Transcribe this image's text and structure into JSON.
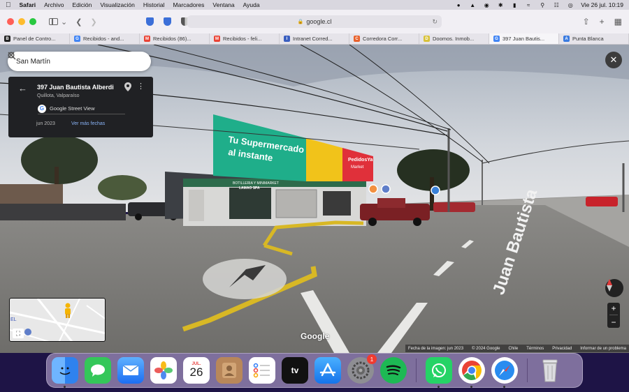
{
  "menubar": {
    "apple_icon": "apple-logo",
    "app_name": "Safari",
    "menus": [
      "Archivo",
      "Edición",
      "Visualización",
      "Historial",
      "Marcadores",
      "Ventana",
      "Ayuda"
    ],
    "datetime": "Vie 26 jul.  10:19"
  },
  "browser": {
    "url": "google.cl",
    "tabs": [
      {
        "label": "Panel de Contro...",
        "favicon": "B",
        "color": "#222222"
      },
      {
        "label": "Recibidos - and...",
        "favicon": "G",
        "color": "#4285f4"
      },
      {
        "label": "Recibidos (86)...",
        "favicon": "M",
        "color": "#ea4335"
      },
      {
        "label": "Recibidos - feli...",
        "favicon": "M",
        "color": "#ea4335"
      },
      {
        "label": "Intranet Corred...",
        "favicon": "I",
        "color": "#3b5fc0"
      },
      {
        "label": "Corredora Corr...",
        "favicon": "C",
        "color": "#e8612c"
      },
      {
        "label": "Doomos. Inmob...",
        "favicon": "D",
        "color": "#d8c23a"
      },
      {
        "label": "397 Juan Bautis...",
        "favicon": "G",
        "color": "#4285f4"
      },
      {
        "label": "Punta Blanca",
        "favicon": "A",
        "color": "#3a7be0"
      }
    ],
    "active_tab": 7
  },
  "streetview": {
    "search_query": "San Martín",
    "address": "397 Juan Bautista Alberdi",
    "locality": "Quillota, Valparaíso",
    "provider": "Google Street View",
    "capture_date": "jun 2023",
    "more_dates": "Ver más fechas",
    "billboard_line1": "Tu Supermercado",
    "billboard_line2": "al instante",
    "billboard_brand": "PedidosYa",
    "billboard_brand2": "Market",
    "store_sign": "BOTILLERIA Y MINIMARKET",
    "store_sign2": "LAMAO SPA",
    "street_name": "Juan Bautista",
    "google_logo": "Google",
    "footer": {
      "image_date": "Fecha de la imagen: jun 2023",
      "copyright": "© 2024 Google",
      "country": "Chile",
      "terms": "Términos",
      "privacy": "Privacidad",
      "report": "Informar de un problema"
    },
    "minimap_label": "EL"
  },
  "dock": {
    "apps": [
      {
        "name": "finder",
        "color": "#3d8df0"
      },
      {
        "name": "messages",
        "color": "#34c759"
      },
      {
        "name": "mail",
        "color": "#2f7cf6"
      },
      {
        "name": "photos",
        "color": "#ffffff"
      },
      {
        "name": "calendar",
        "color": "#ffffff"
      },
      {
        "name": "contacts",
        "color": "#b8875a"
      },
      {
        "name": "reminders",
        "color": "#ffffff"
      },
      {
        "name": "apple-tv",
        "color": "#111111"
      },
      {
        "name": "app-store",
        "color": "#1c8cf5"
      },
      {
        "name": "system-settings",
        "color": "#8e8e93"
      },
      {
        "name": "spotify",
        "color": "#1db954"
      },
      {
        "name": "whatsapp",
        "color": "#25d366"
      },
      {
        "name": "chrome",
        "color": "#ffffff"
      },
      {
        "name": "safari",
        "color": "#2a8cf0"
      },
      {
        "name": "trash",
        "color": "#d8d8dc"
      }
    ],
    "calendar_month": "JUL.",
    "calendar_day": "26",
    "settings_badge": "1",
    "tv_label": "tv"
  }
}
